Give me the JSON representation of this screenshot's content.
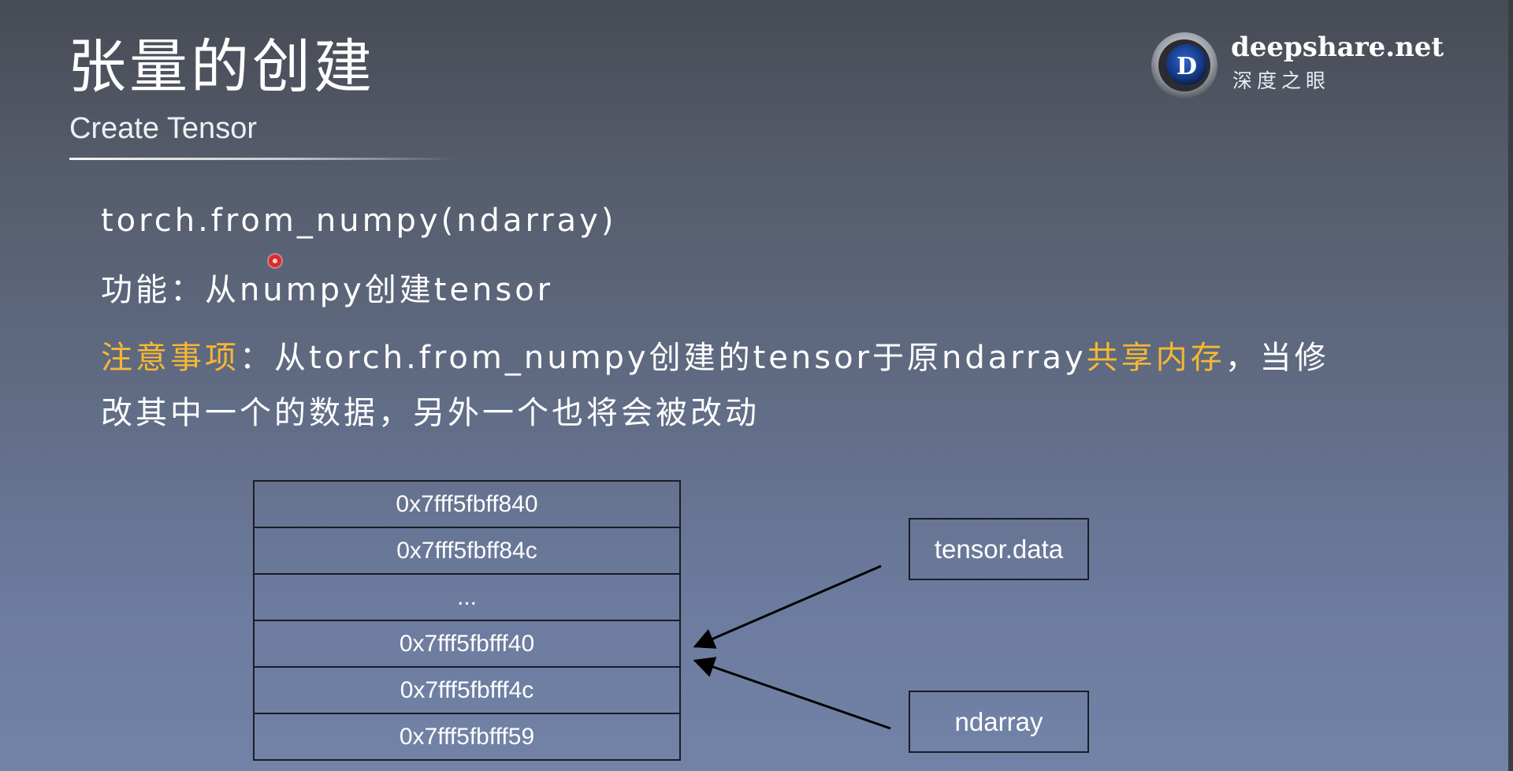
{
  "slide": {
    "title": "张量的创建",
    "subtitle": "Create Tensor"
  },
  "logo": {
    "name": "deepshare.net",
    "cn": "深度之眼",
    "mark_letter": "D"
  },
  "content": {
    "func_signature": "torch.from_numpy(ndarray)",
    "description": "功能：从numpy创建tensor",
    "note": {
      "label": "注意事项",
      "sep": "：",
      "text_a": "从torch.from_numpy创建的tensor于原ndarray",
      "highlight": "共享内存",
      "text_b": "，当修",
      "line2": "改其中一个的数据，另外一个也将会被改动"
    }
  },
  "memory_table": {
    "rows": [
      "0x7fff5fbff840",
      "0x7fff5fbff84c",
      "...",
      "0x7fff5fbfff40",
      "0x7fff5fbfff4c",
      "0x7fff5fbfff59"
    ]
  },
  "labels": {
    "tensor": "tensor.data",
    "ndarray": "ndarray"
  },
  "colors": {
    "highlight": "#f6b732",
    "text": "#ffffff",
    "border": "#1a1d24",
    "pointer": "#e12828"
  }
}
